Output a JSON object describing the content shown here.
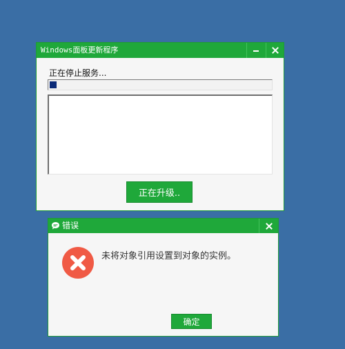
{
  "colors": {
    "desktop": "#3a6ea5",
    "accent": "#1fa83a",
    "progress": "#0b2a78",
    "error": "#f05a45"
  },
  "main_window": {
    "title": "Windows面板更新程序",
    "status": "正在停止服务...",
    "progress_fraction": 0.03,
    "log_text": "",
    "action_button": "正在升级..",
    "icons": {
      "minimize": "minimize-icon",
      "close": "close-icon"
    }
  },
  "error_dialog": {
    "title": "错误",
    "message": "未将对象引用设置到对象的实例。",
    "ok_button": "确定",
    "icons": {
      "app": "chat-bubble-icon",
      "error": "error-x-icon",
      "close": "close-icon"
    }
  }
}
